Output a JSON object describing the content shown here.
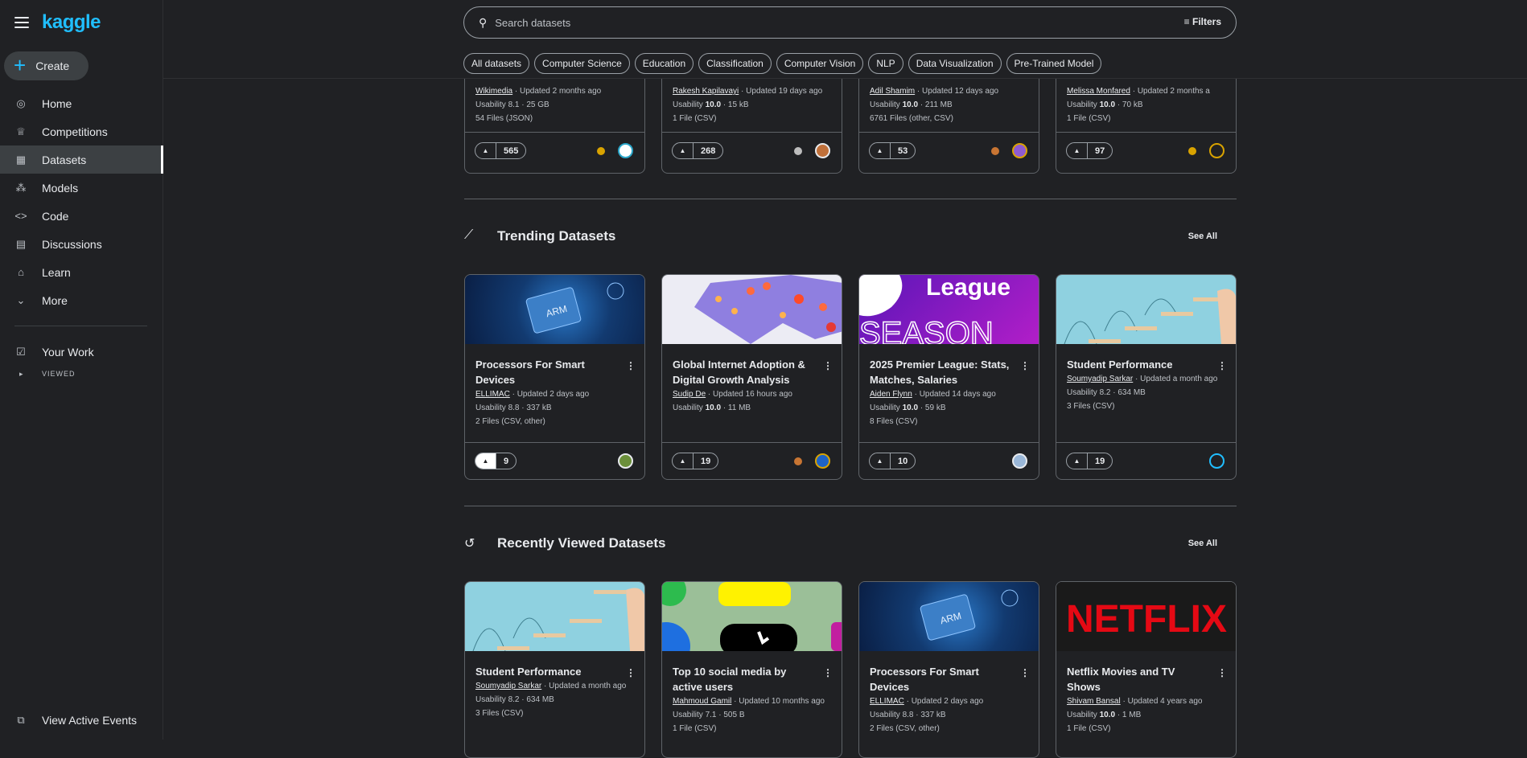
{
  "app": {
    "logo": "kaggle",
    "create_label": "Create"
  },
  "search": {
    "placeholder": "Search datasets",
    "filters_label": "Filters"
  },
  "chips": [
    "All datasets",
    "Computer Science",
    "Education",
    "Classification",
    "Computer Vision",
    "NLP",
    "Data Visualization",
    "Pre-Trained Model"
  ],
  "nav": [
    {
      "label": "Home",
      "icon": "compass-icon"
    },
    {
      "label": "Competitions",
      "icon": "trophy-icon"
    },
    {
      "label": "Datasets",
      "icon": "table-icon",
      "active": true
    },
    {
      "label": "Models",
      "icon": "models-icon"
    },
    {
      "label": "Code",
      "icon": "code-icon"
    },
    {
      "label": "Discussions",
      "icon": "comment-icon"
    },
    {
      "label": "Learn",
      "icon": "school-icon"
    },
    {
      "label": "More",
      "icon": "chevron-down-icon"
    }
  ],
  "your_work": "Your Work",
  "viewed_label": "VIEWED",
  "active_events": "View Active Events",
  "top_cards": [
    {
      "author": "Wikimedia",
      "updated": "Updated 2 months ago",
      "usability_prefix": "Usability ",
      "usability": "8.1",
      "size": " · 25 GB",
      "files": "54 Files (JSON)",
      "votes": "565"
    },
    {
      "author": "Rakesh Kapilavayi",
      "updated": "Updated 19 days ago",
      "usability_prefix": "Usability ",
      "usability": "10.0",
      "size": " · 15 kB",
      "files": "1 File (CSV)",
      "votes": "268"
    },
    {
      "author": "Adil Shamim",
      "updated": "Updated 12 days ago",
      "usability_prefix": "Usability ",
      "usability": "10.0",
      "size": " · 211 MB",
      "files": "6761 Files (other, CSV)",
      "votes": "53"
    },
    {
      "author": "Melissa Monfared",
      "updated": "Updated 2 months a",
      "usability_prefix": "Usability ",
      "usability": "10.0",
      "size": " · 70 kB",
      "files": "1 File (CSV)",
      "votes": "97"
    }
  ],
  "trending": {
    "title": "Trending Datasets",
    "see_all": "See All",
    "cards": [
      {
        "title": "Processors For Smart Devices",
        "author": "ELLIMAC",
        "updated": "Updated 2 days ago",
        "usability_prefix": "Usability ",
        "usability": "8.8",
        "size": " · 337 kB",
        "files": "2 Files (CSV, other)",
        "votes": "9"
      },
      {
        "title": "Global Internet Adoption & Digital Growth Analysis",
        "author": "Sudip De",
        "updated": "Updated 16 hours ago",
        "usability_prefix": "Usability ",
        "usability": "10.0",
        "size": " · 11 MB",
        "files": "",
        "votes": "19"
      },
      {
        "title": "2025 Premier League: Stats, Matches, Salaries",
        "author": "Aiden Flynn",
        "updated": "Updated 14 days ago",
        "usability_prefix": "Usability ",
        "usability": "10.0",
        "size": " · 59 kB",
        "files": "8 Files (CSV)",
        "votes": "10",
        "thumb_text1": "League",
        "thumb_text2": "SEASON"
      },
      {
        "title": "Student Performance",
        "author": "Soumyadip Sarkar",
        "updated": "Updated a month ago",
        "usability_prefix": "Usability ",
        "usability": "8.2",
        "size": " · 634 MB",
        "files": "3 Files (CSV)",
        "votes": "19"
      }
    ]
  },
  "recent": {
    "title": "Recently Viewed Datasets",
    "see_all": "See All",
    "cards": [
      {
        "title": "Student Performance",
        "author": "Soumyadip Sarkar",
        "updated": "Updated a month ago",
        "usability_prefix": "Usability ",
        "usability": "8.2",
        "size": " · 634 MB",
        "files": "3 Files (CSV)"
      },
      {
        "title": "Top 10 social media by active users",
        "author": "Mahmoud Gamil",
        "updated": "Updated 10 months ago",
        "usability_prefix": "Usability ",
        "usability": "7.1",
        "size": " · 505 B",
        "files": "1 File (CSV)"
      },
      {
        "title": "Processors For Smart Devices",
        "author": "ELLIMAC",
        "updated": "Updated 2 days ago",
        "usability_prefix": "Usability ",
        "usability": "8.8",
        "size": " · 337 kB",
        "files": "2 Files (CSV, other)"
      },
      {
        "title": "Netflix Movies and TV Shows",
        "author": "Shivam Bansal",
        "updated": "Updated 4 years ago",
        "usability_prefix": "Usability ",
        "usability": "10.0",
        "size": " · 1 MB",
        "files": "1 File (CSV)",
        "thumb_text": "NETFLIX"
      }
    ]
  },
  "colors": {
    "accent": "#20beff",
    "background": "#202124",
    "border": "#5f6368"
  }
}
